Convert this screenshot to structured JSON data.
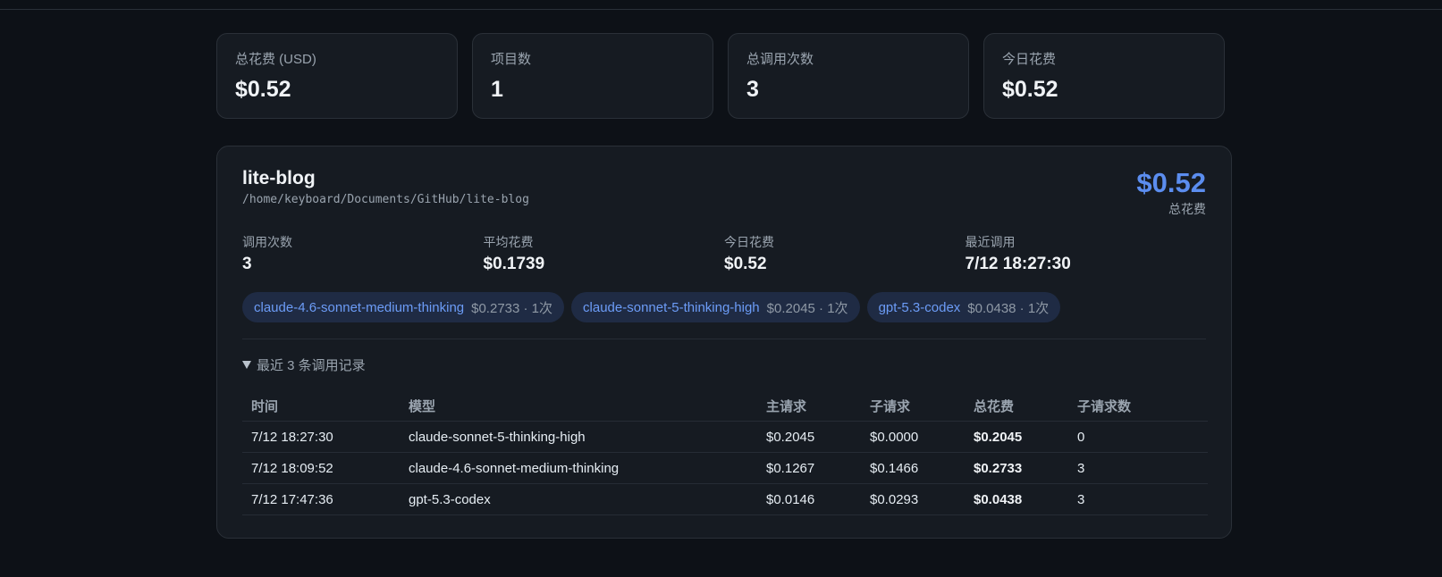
{
  "summary": {
    "cards": [
      {
        "label": "总花费 (USD)",
        "value": "$0.52"
      },
      {
        "label": "项目数",
        "value": "1"
      },
      {
        "label": "总调用次数",
        "value": "3"
      },
      {
        "label": "今日花费",
        "value": "$0.52"
      }
    ]
  },
  "project": {
    "name": "lite-blog",
    "path": "/home/keyboard/Documents/GitHub/lite-blog",
    "total_value": "$0.52",
    "total_label": "总花费",
    "metrics": [
      {
        "label": "调用次数",
        "value": "3"
      },
      {
        "label": "平均花费",
        "value": "$0.1739"
      },
      {
        "label": "今日花费",
        "value": "$0.52"
      },
      {
        "label": "最近调用",
        "value": "7/12 18:27:30"
      }
    ],
    "chips": [
      {
        "model": "claude-4.6-sonnet-medium-thinking",
        "meta": "$0.2733 · 1次"
      },
      {
        "model": "claude-sonnet-5-thinking-high",
        "meta": "$0.2045 · 1次"
      },
      {
        "model": "gpt-5.3-codex",
        "meta": "$0.0438 · 1次"
      }
    ],
    "history_label": "最近 3 条调用记录",
    "table": {
      "headers": [
        "时间",
        "模型",
        "主请求",
        "子请求",
        "总花费",
        "子请求数"
      ],
      "rows": [
        [
          "7/12 18:27:30",
          "claude-sonnet-5-thinking-high",
          "$0.2045",
          "$0.0000",
          "$0.2045",
          "0"
        ],
        [
          "7/12 18:09:52",
          "claude-4.6-sonnet-medium-thinking",
          "$0.1267",
          "$0.1466",
          "$0.2733",
          "3"
        ],
        [
          "7/12 17:47:36",
          "gpt-5.3-codex",
          "$0.0146",
          "$0.0293",
          "$0.0438",
          "3"
        ]
      ]
    }
  },
  "colors": {
    "background": "#0d1117",
    "card": "#161b22",
    "accent": "#5b8def",
    "chip_bg": "#1f2b44"
  }
}
